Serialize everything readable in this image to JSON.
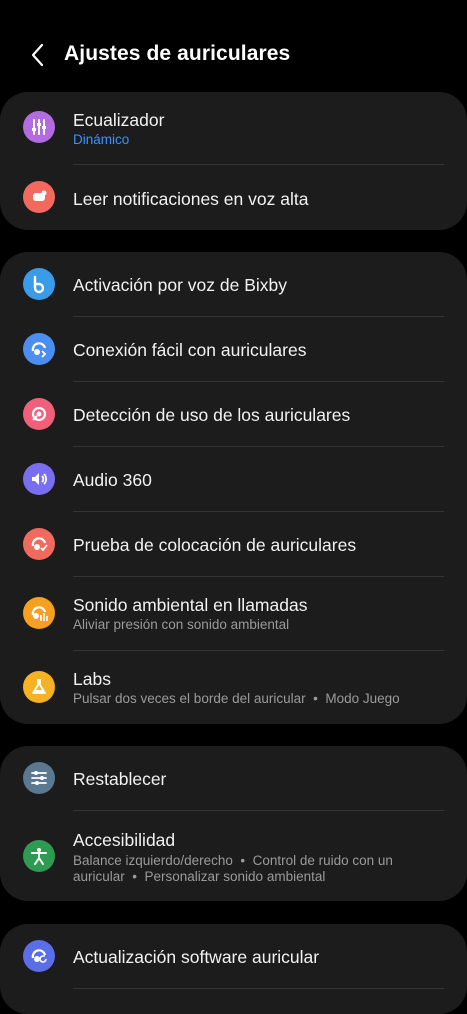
{
  "header": {
    "title": "Ajustes de auriculares"
  },
  "colors": {
    "accent_blue": "#3e91ff",
    "background": "#000000",
    "card": "#1c1c1c"
  },
  "group1": [
    {
      "label": "Ecualizador",
      "sub": "Dinámico",
      "icon": "equalizer-icon",
      "color": "#b36be0"
    },
    {
      "label": "Leer notificaciones en voz alta",
      "icon": "notification-voice-icon",
      "color": "#f26a5e"
    }
  ],
  "group2": [
    {
      "label": "Activación por voz de Bixby",
      "icon": "bixby-icon",
      "color": "#3a9ce8"
    },
    {
      "label": "Conexión fácil con auriculares",
      "icon": "easy-connect-icon",
      "color": "#4c8ef0"
    },
    {
      "label": "Detección de uso de los auriculares",
      "icon": "wear-detection-icon",
      "color": "#f0607a"
    },
    {
      "label": "Audio 360",
      "icon": "speaker-icon",
      "color": "#7a6ef0"
    },
    {
      "label": "Prueba de colocación de auriculares",
      "icon": "fit-test-icon",
      "color": "#f26a5e"
    },
    {
      "label": "Sonido ambiental en llamadas",
      "sub": "Aliviar presión con sonido ambiental",
      "icon": "ambient-sound-icon",
      "color": "#f5a020"
    },
    {
      "label": "Labs",
      "sub": "Pulsar dos veces el borde del auricular  •  Modo Juego",
      "icon": "flask-icon",
      "color": "#f5b224"
    }
  ],
  "group3": [
    {
      "label": "Restablecer",
      "icon": "sliders-icon",
      "color": "#5a7890"
    },
    {
      "label": "Accesibilidad",
      "sub": "Balance izquierdo/derecho  •  Control de ruido con un auricular  •  Personalizar sonido ambiental",
      "icon": "accessibility-icon",
      "color": "#2e9a52"
    }
  ],
  "group4": [
    {
      "label": "Actualización software auricular",
      "icon": "software-update-icon",
      "color": "#5a6ee8"
    }
  ]
}
